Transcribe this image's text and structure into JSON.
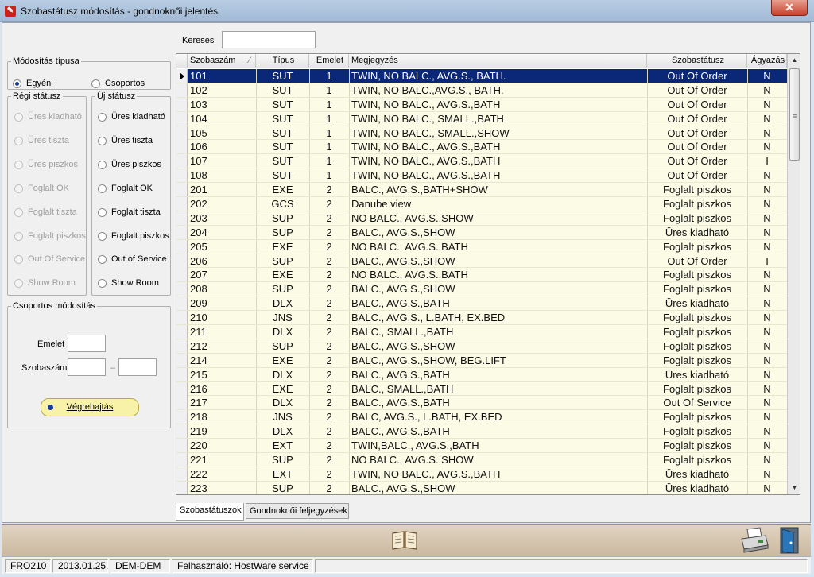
{
  "window": {
    "title": "Szobastátusz módosítás - gondnoknői jelentés"
  },
  "search": {
    "label": "Keresés",
    "value": ""
  },
  "modify_type": {
    "legend": "Módosítás típusa",
    "options": [
      {
        "label": "Egyéni",
        "checked": true
      },
      {
        "label": "Csoportos",
        "checked": false
      }
    ]
  },
  "old_status": {
    "legend": "Régi státusz",
    "options": [
      "Üres kiadható",
      "Üres tiszta",
      "Üres piszkos",
      "Foglalt OK",
      "Foglalt tiszta",
      "Foglalt piszkos",
      "Out Of Service",
      "Show Room"
    ]
  },
  "new_status": {
    "legend": "Új státusz",
    "options": [
      "Üres kiadható",
      "Üres tiszta",
      "Üres piszkos",
      "Foglalt OK",
      "Foglalt tiszta",
      "Foglalt piszkos",
      "Out of Service",
      "Show Room"
    ]
  },
  "group_modify": {
    "legend": "Csoportos módosítás",
    "floor_label": "Emelet",
    "room_label": "Szobaszám",
    "range_sep": "–",
    "execute_label": "Végrehajtás"
  },
  "table": {
    "columns": [
      "Szobaszám",
      "Típus",
      "Emelet",
      "Megjegyzés",
      "Szobastátusz",
      "Ágyazás"
    ],
    "sort_indicator": "⁄",
    "rows": [
      [
        "101",
        "SUT",
        "1",
        "TWIN, NO BALC., AVG.S., BATH.",
        "Out Of Order",
        "N"
      ],
      [
        "102",
        "SUT",
        "1",
        "TWIN, NO BALC.,AVG.S., BATH.",
        "Out Of Order",
        "N"
      ],
      [
        "103",
        "SUT",
        "1",
        "TWIN, NO BALC., AVG.S.,BATH",
        "Out Of Order",
        "N"
      ],
      [
        "104",
        "SUT",
        "1",
        "TWIN, NO BALC., SMALL.,BATH",
        "Out Of Order",
        "N"
      ],
      [
        "105",
        "SUT",
        "1",
        "TWIN, NO BALC., SMALL.,SHOW",
        "Out Of Order",
        "N"
      ],
      [
        "106",
        "SUT",
        "1",
        "TWIN, NO BALC., AVG.S.,BATH",
        "Out Of Order",
        "N"
      ],
      [
        "107",
        "SUT",
        "1",
        "TWIN, NO BALC., AVG.S.,BATH",
        "Out Of Order",
        "I"
      ],
      [
        "108",
        "SUT",
        "1",
        "TWIN, NO BALC., AVG.S.,BATH",
        "Out Of Order",
        "N"
      ],
      [
        "201",
        "EXE",
        "2",
        "BALC., AVG.S.,BATH+SHOW",
        "Foglalt piszkos",
        "N"
      ],
      [
        "202",
        "GCS",
        "2",
        "Danube view",
        "Foglalt piszkos",
        "N"
      ],
      [
        "203",
        "SUP",
        "2",
        "NO BALC., AVG.S.,SHOW",
        "Foglalt piszkos",
        "N"
      ],
      [
        "204",
        "SUP",
        "2",
        "BALC., AVG.S.,SHOW",
        "Üres kiadható",
        "N"
      ],
      [
        "205",
        "EXE",
        "2",
        "NO BALC., AVG.S.,BATH",
        "Foglalt piszkos",
        "N"
      ],
      [
        "206",
        "SUP",
        "2",
        "BALC., AVG.S.,SHOW",
        "Out Of Order",
        "I"
      ],
      [
        "207",
        "EXE",
        "2",
        "NO BALC., AVG.S.,BATH",
        "Foglalt piszkos",
        "N"
      ],
      [
        "208",
        "SUP",
        "2",
        "BALC., AVG.S.,SHOW",
        "Foglalt piszkos",
        "N"
      ],
      [
        "209",
        "DLX",
        "2",
        "BALC., AVG.S.,BATH",
        "Üres kiadható",
        "N"
      ],
      [
        "210",
        "JNS",
        "2",
        "BALC., AVG.S., L.BATH, EX.BED",
        "Foglalt piszkos",
        "N"
      ],
      [
        "211",
        "DLX",
        "2",
        "BALC., SMALL.,BATH",
        "Foglalt piszkos",
        "N"
      ],
      [
        "212",
        "SUP",
        "2",
        "BALC., AVG.S.,SHOW",
        "Foglalt piszkos",
        "N"
      ],
      [
        "214",
        "EXE",
        "2",
        "BALC., AVG.S.,SHOW, BEG.LIFT",
        "Foglalt piszkos",
        "N"
      ],
      [
        "215",
        "DLX",
        "2",
        "BALC., AVG.S.,BATH",
        "Üres kiadható",
        "N"
      ],
      [
        "216",
        "EXE",
        "2",
        "BALC., SMALL.,BATH",
        "Foglalt piszkos",
        "N"
      ],
      [
        "217",
        "DLX",
        "2",
        "BALC., AVG.S.,BATH",
        "Out Of Service",
        "N"
      ],
      [
        "218",
        "JNS",
        "2",
        "BALC, AVG.S., L.BATH, EX.BED",
        "Foglalt piszkos",
        "N"
      ],
      [
        "219",
        "DLX",
        "2",
        "BALC., AVG.S.,BATH",
        "Foglalt piszkos",
        "N"
      ],
      [
        "220",
        "EXT",
        "2",
        "TWIN,BALC., AVG.S.,BATH",
        "Foglalt piszkos",
        "N"
      ],
      [
        "221",
        "SUP",
        "2",
        "NO BALC., AVG.S.,SHOW",
        "Foglalt piszkos",
        "N"
      ],
      [
        "222",
        "EXT",
        "2",
        "TWIN, NO BALC., AVG.S.,BATH",
        "Üres kiadható",
        "N"
      ],
      [
        "223",
        "SUP",
        "2",
        "BALC., AVG.S.,SHOW",
        "Üres kiadható",
        "N"
      ]
    ],
    "selected_row": 0
  },
  "tabs": [
    "Szobastátuszok",
    "Gondnoknői feljegyzések"
  ],
  "toolbar": {
    "icons": [
      "book-icon",
      "printer-icon",
      "exit-door-icon"
    ]
  },
  "status_bar": [
    "FRO210",
    "2013.01.25.",
    "DEM-DEM",
    "Felhasználó: HostWare service"
  ],
  "colors": {
    "selected_row": "#0a2778",
    "row_bg": "#fbfbe6",
    "exec_button": "#f8f2a8",
    "toolbar": "#cbb9a0"
  }
}
